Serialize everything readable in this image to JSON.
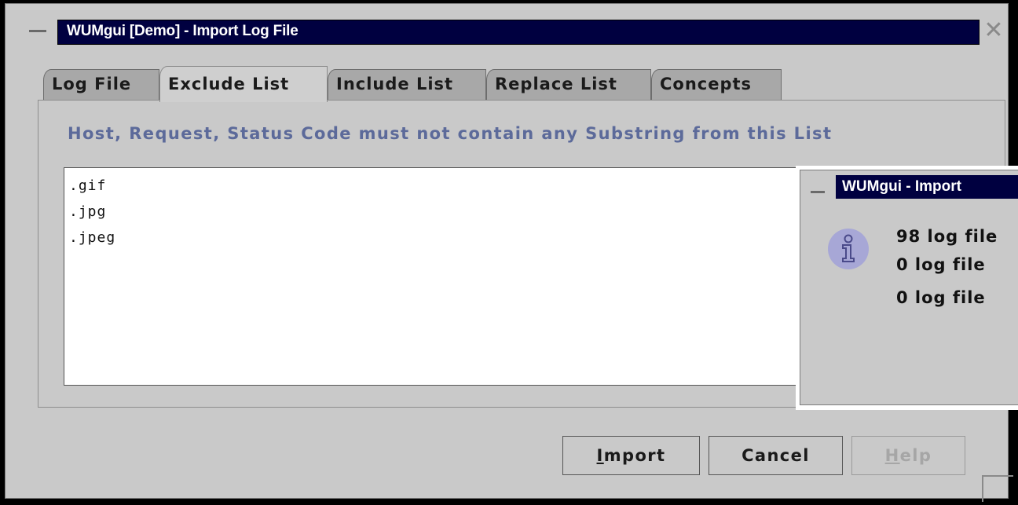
{
  "window": {
    "title": "WUMgui [Demo] - Import Log File",
    "close_glyph": "✕"
  },
  "tabs": [
    {
      "label": "Log File",
      "active": false
    },
    {
      "label": "Exclude List",
      "active": true
    },
    {
      "label": "Include List",
      "active": false
    },
    {
      "label": "Replace List",
      "active": false
    },
    {
      "label": "Concepts",
      "active": false
    }
  ],
  "exclude": {
    "description": "Host, Request, Status Code must not contain any Substring from this List",
    "items": [
      ".gif",
      ".jpg",
      ".jpeg"
    ]
  },
  "buttons": {
    "import_label": "Import",
    "import_mnemonic": "I",
    "import_rest": "mport",
    "cancel_label": "Cancel",
    "help_label": "Help",
    "help_mnemonic": "H",
    "help_rest": "elp",
    "help_enabled": false
  },
  "dialog": {
    "title": "WUMgui - Import",
    "icon": "info-icon",
    "lines": [
      "98 log file",
      "0 log file",
      "0 log file"
    ]
  },
  "colors": {
    "title_bar": "#000040",
    "description_text": "#5c6a9a",
    "window_bg": "#c9c9c9"
  }
}
